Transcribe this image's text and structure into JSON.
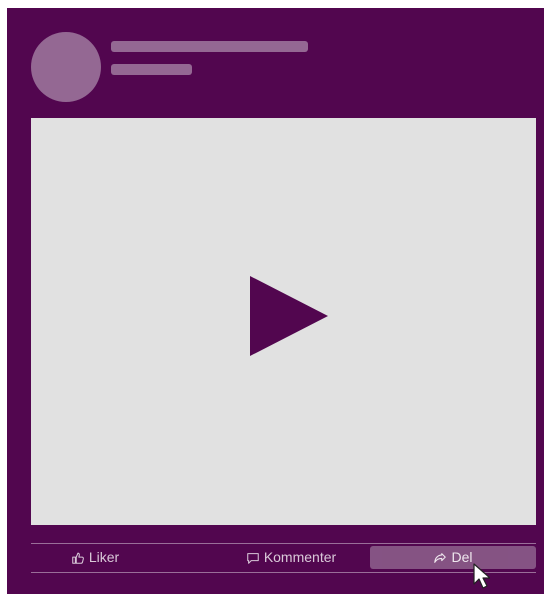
{
  "post": {
    "actions": {
      "like_label": "Liker",
      "comment_label": "Kommenter",
      "share_label": "Del"
    }
  },
  "colors": {
    "card_background": "#52064f",
    "video_background": "#e1e1e1",
    "placeholder": "#946893",
    "active_action": "#8b5c89"
  },
  "icons": {
    "play": "play-icon",
    "like": "thumbs-up-icon",
    "comment": "speech-bubble-icon",
    "share": "share-arrow-icon",
    "cursor": "mouse-pointer-icon"
  }
}
